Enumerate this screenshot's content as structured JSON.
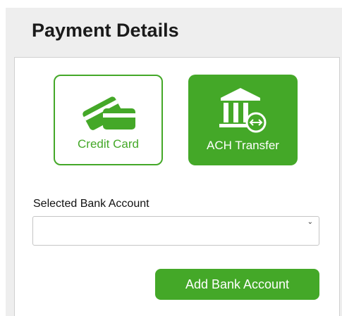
{
  "header": {
    "title": "Payment Details"
  },
  "payment_methods": [
    {
      "label": "Credit Card",
      "icon": "credit-card-icon",
      "selected": false
    },
    {
      "label": "ACH Transfer",
      "icon": "bank-transfer-icon",
      "selected": true
    }
  ],
  "bank_account": {
    "label": "Selected Bank Account",
    "value": ""
  },
  "actions": {
    "add_bank_account_label": "Add Bank Account"
  },
  "colors": {
    "accent": "#44a828",
    "panel_bg": "#eeeeee",
    "border": "#c5c5c5"
  }
}
